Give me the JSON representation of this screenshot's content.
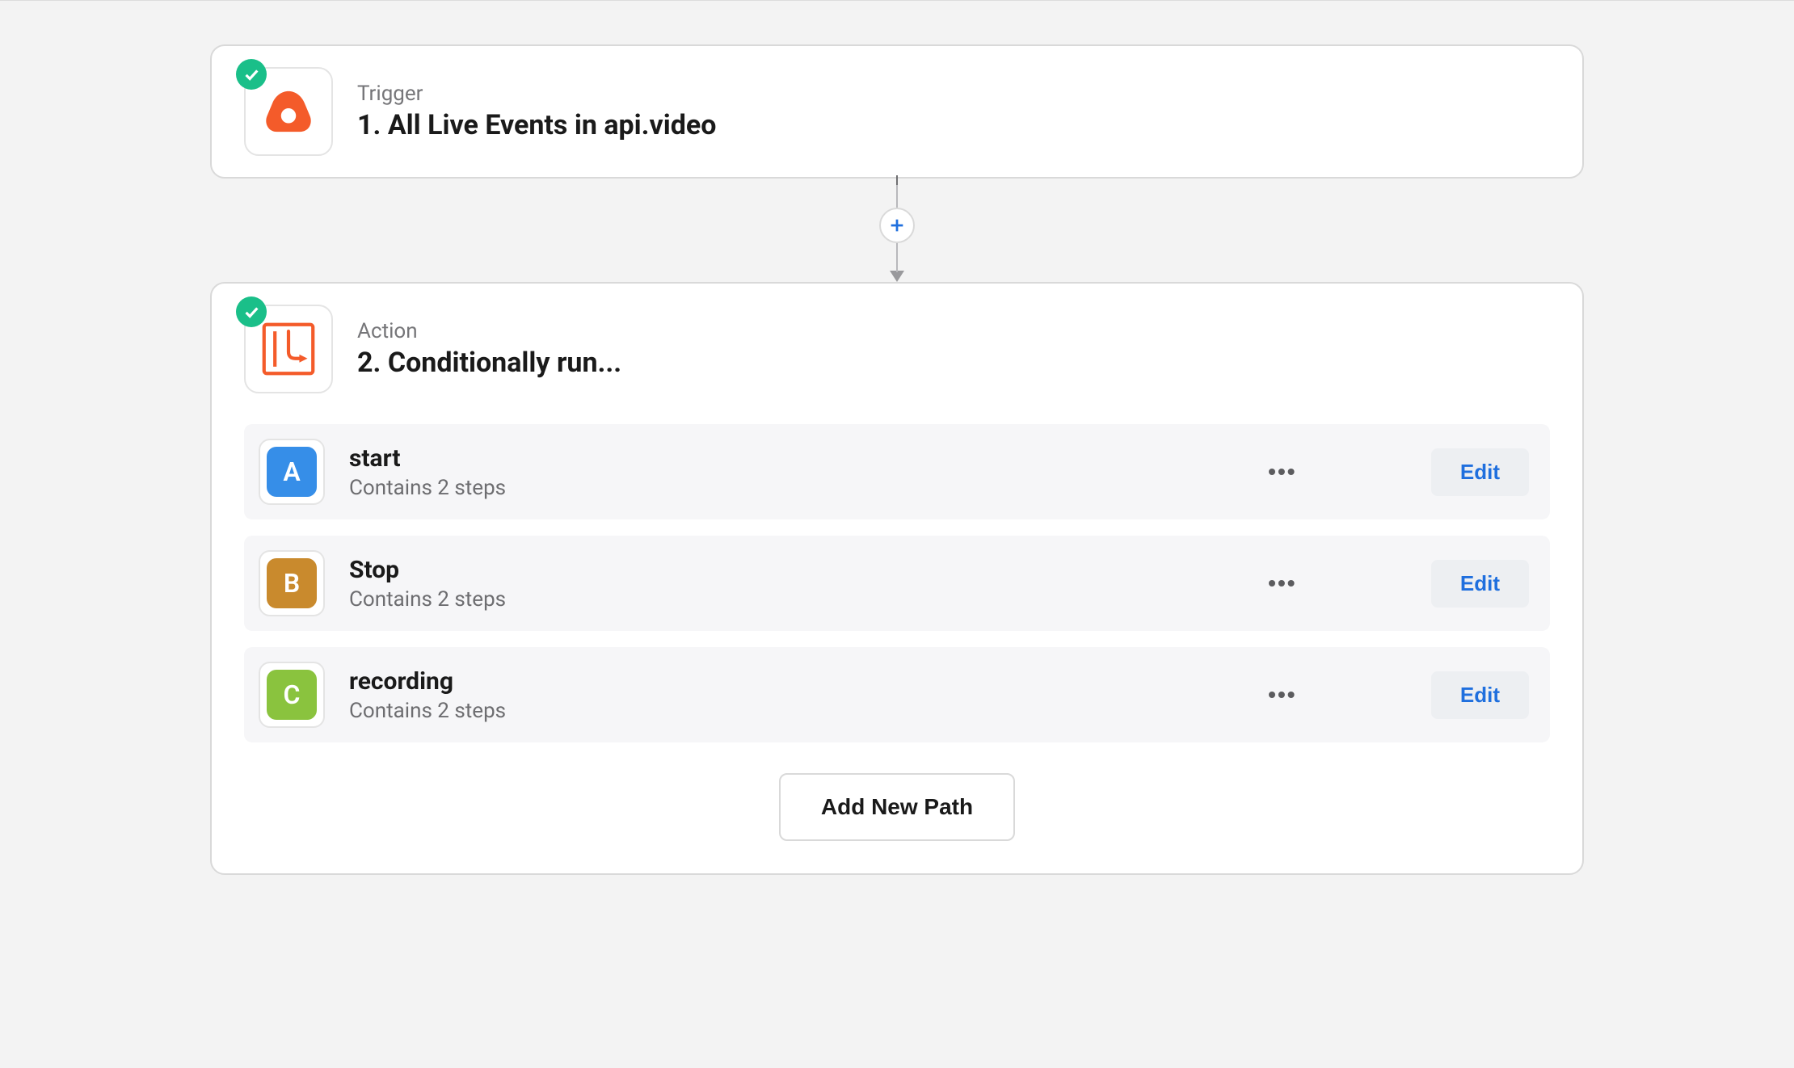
{
  "trigger": {
    "kicker": "Trigger",
    "title": "1. All Live Events in api.video",
    "icon_name": "api-video-logo"
  },
  "connector": {
    "add_label": "+"
  },
  "action": {
    "kicker": "Action",
    "title": "2. Conditionally run...",
    "icon_name": "paths-icon",
    "paths": [
      {
        "letter": "A",
        "letter_class": "letter-a",
        "name": "start",
        "sub": "Contains 2 steps",
        "edit": "Edit"
      },
      {
        "letter": "B",
        "letter_class": "letter-b",
        "name": "Stop",
        "sub": "Contains 2 steps",
        "edit": "Edit"
      },
      {
        "letter": "C",
        "letter_class": "letter-c",
        "name": "recording",
        "sub": "Contains 2 steps",
        "edit": "Edit"
      }
    ],
    "add_path_label": "Add New Path"
  }
}
